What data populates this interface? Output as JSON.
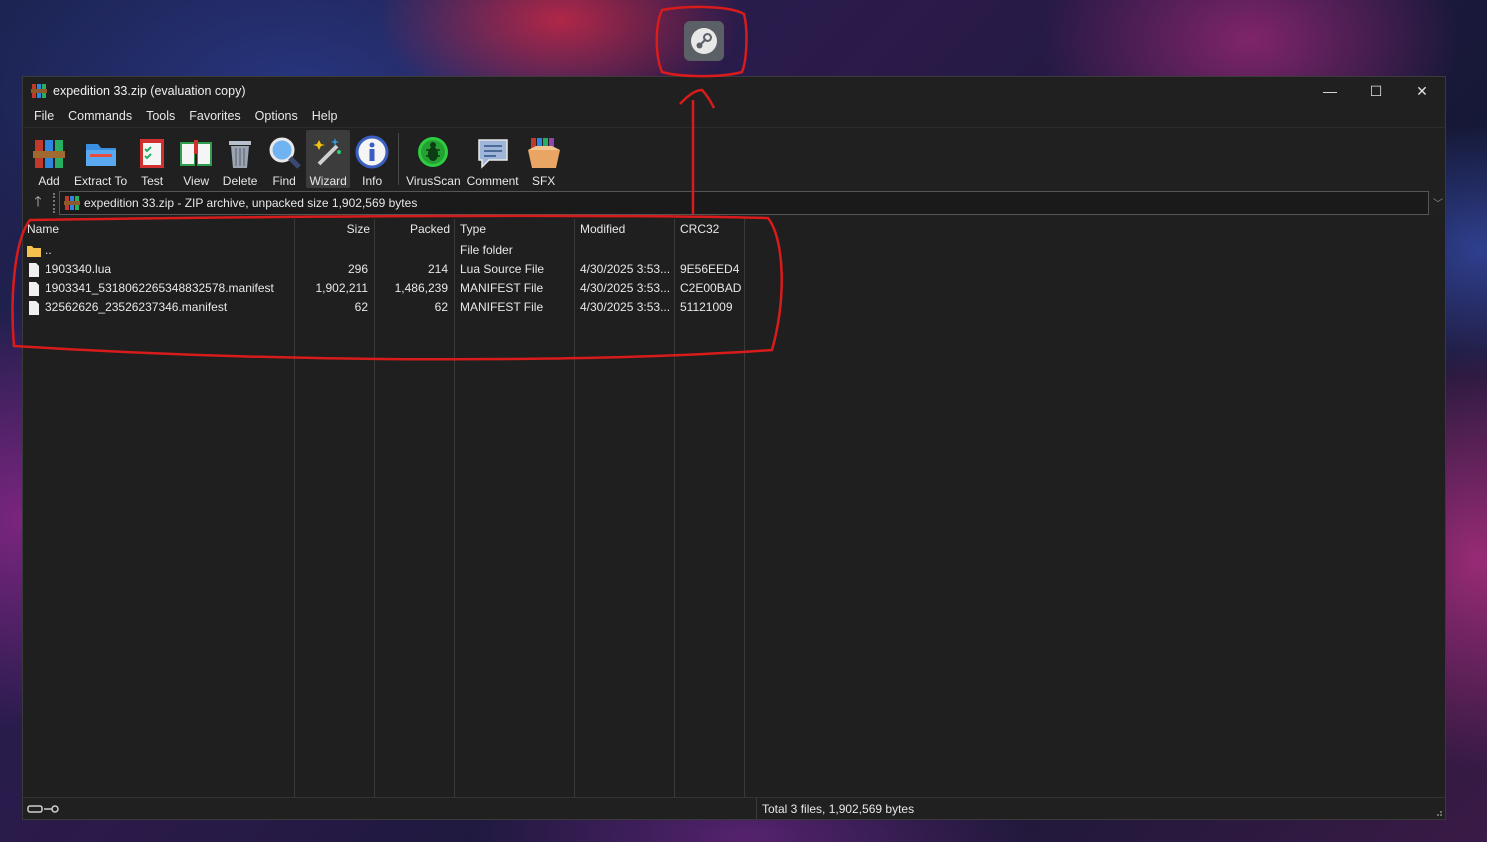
{
  "desktop": {
    "taskbar_icon": "steam-icon"
  },
  "window": {
    "title": "expedition 33.zip (evaluation copy)",
    "controls": {
      "minimize": "—",
      "maximize": "☐",
      "close": "✕"
    }
  },
  "menu": [
    "File",
    "Commands",
    "Tools",
    "Favorites",
    "Options",
    "Help"
  ],
  "toolbar": {
    "add": "Add",
    "extract": "Extract To",
    "test": "Test",
    "view": "View",
    "delete": "Delete",
    "find": "Find",
    "wizard": "Wizard",
    "info": "Info",
    "virusscan": "VirusScan",
    "comment": "Comment",
    "sfx": "SFX"
  },
  "address": {
    "path": "expedition 33.zip - ZIP archive, unpacked size 1,902,569 bytes"
  },
  "columns": {
    "name": "Name",
    "size": "Size",
    "packed": "Packed",
    "type": "Type",
    "modified": "Modified",
    "crc": "CRC32"
  },
  "files": [
    {
      "name": "..",
      "size": "",
      "packed": "",
      "type": "File folder",
      "modified": "",
      "crc": "",
      "icon": "folder-icon"
    },
    {
      "name": "1903340.lua",
      "size": "296",
      "packed": "214",
      "type": "Lua Source File",
      "modified": "4/30/2025 3:53...",
      "crc": "9E56EED4",
      "icon": "file-icon"
    },
    {
      "name": "1903341_5318062265348832578.manifest",
      "size": "1,902,211",
      "packed": "1,486,239",
      "type": "MANIFEST File",
      "modified": "4/30/2025 3:53...",
      "crc": "C2E00BAD",
      "icon": "file-icon"
    },
    {
      "name": "32562626_23526237346.manifest",
      "size": "62",
      "packed": "62",
      "type": "MANIFEST File",
      "modified": "4/30/2025 3:53...",
      "crc": "51121009",
      "icon": "file-icon"
    }
  ],
  "status": {
    "total": "Total 3 files, 1,902,569 bytes"
  },
  "colors": {
    "annotation": "#d81b1b",
    "window_bg": "#1f1f1f"
  }
}
